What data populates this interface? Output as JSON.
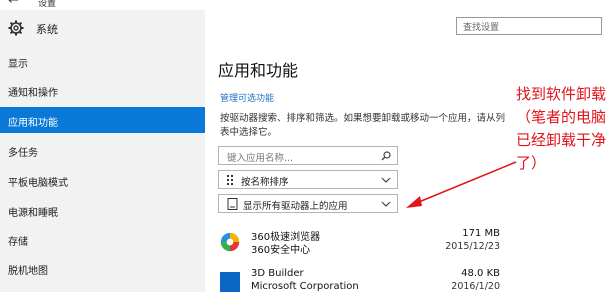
{
  "window": {
    "title": "设置",
    "back_glyph": "←"
  },
  "sidebar": {
    "header": "系统",
    "items": [
      {
        "label": "显示",
        "active": false
      },
      {
        "label": "通知和操作",
        "active": false
      },
      {
        "label": "应用和功能",
        "active": true
      },
      {
        "label": "多任务",
        "active": false
      },
      {
        "label": "平板电脑模式",
        "active": false
      },
      {
        "label": "电源和睡眠",
        "active": false
      },
      {
        "label": "存储",
        "active": false
      },
      {
        "label": "脱机地图",
        "active": false
      }
    ]
  },
  "search": {
    "placeholder": "查找设置"
  },
  "main": {
    "title": "应用和功能",
    "manage_link": "管理可选功能",
    "description": "按驱动器搜索、排序和筛选。如果想要卸载或移动一个应用，请从列表中选择它。",
    "app_search_placeholder": "键入应用名称...",
    "sort_label": "按名称排序",
    "filter_label": "显示所有驱动器上的应用",
    "apps": [
      {
        "name": "360极速浏览器",
        "publisher": "360安全中心",
        "size": "171 MB",
        "date": "2015/12/23"
      },
      {
        "name": "3D Builder",
        "publisher": "Microsoft Corporation",
        "size": "48.0 KB",
        "date": "2016/1/20"
      }
    ]
  },
  "annotation": {
    "text": "找到软件卸载（笔者的电脑已经卸载干净了）"
  },
  "colors": {
    "accent": "#0a78d7",
    "annotation": "#e0141a",
    "link": "#1a6fc2"
  }
}
